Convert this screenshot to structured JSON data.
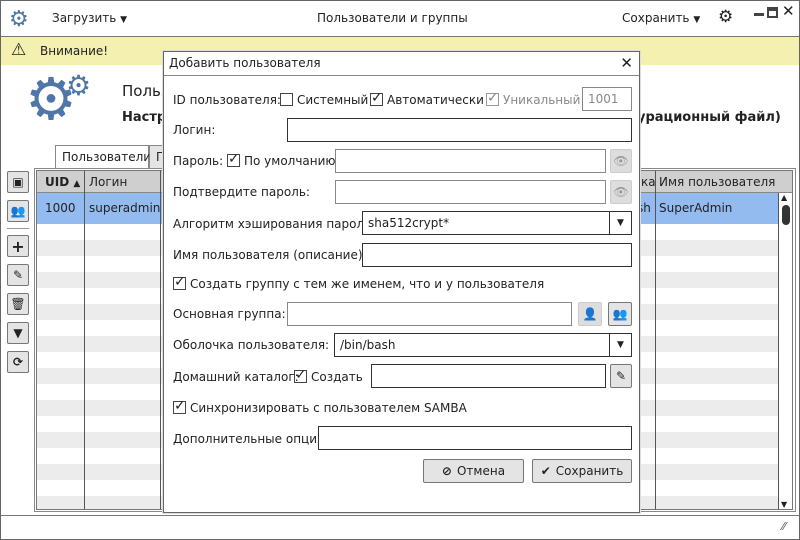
{
  "window": {
    "title": "Пользователи и группы",
    "load_menu": "Загрузить",
    "save_menu": "Сохранить"
  },
  "warning": {
    "text": "Внимание!"
  },
  "header": {
    "title_partial": "Польз",
    "subtitle_partial": "Настр",
    "subtitle_tail": "урационный файл)"
  },
  "tabs": [
    {
      "label": "Пользователи"
    },
    {
      "label": "Г"
    }
  ],
  "table": {
    "columns": [
      "UID",
      "Логин",
      "",
      "",
      "ка",
      "Имя пользователя"
    ],
    "rows": [
      {
        "uid": "1000",
        "login": "superadmin",
        "shell_tail": "sh",
        "name": "SuperAdmin"
      }
    ]
  },
  "dialog": {
    "title": "Добавить пользователя",
    "id_label": "ID пользователя:",
    "system_label": "Системный",
    "system_checked": false,
    "auto_label": "Автоматически",
    "auto_checked": true,
    "unique_label": "Уникальный",
    "unique_checked": true,
    "id_value": "1001",
    "login_label": "Логин:",
    "login_value": "",
    "password_label": "Пароль:",
    "default_label": "По умолчанию",
    "default_checked": true,
    "confirm_label": "Подтвердите пароль:",
    "hash_label": "Алгоритм хэширования пароля:",
    "hash_value": "sha512crypt*",
    "desc_label": "Имя пользователя (описание):",
    "create_group_label": "Создать группу с тем же именем, что и у пользователя",
    "create_group_checked": true,
    "primary_group_label": "Основная группа:",
    "shell_label": "Оболочка пользователя:",
    "shell_value": "/bin/bash",
    "home_label": "Домашний каталог:",
    "home_create_label": "Создать",
    "home_create_checked": true,
    "samba_label": "Синхронизировать с пользователем SAMBA",
    "samba_checked": true,
    "extra_label": "Дополнительные опции:",
    "cancel": "Отмена",
    "save": "Сохранить"
  },
  "colors": {
    "accent": "#5b7fae",
    "selected": "#94bbf0",
    "warning": "#f3f0b0"
  }
}
